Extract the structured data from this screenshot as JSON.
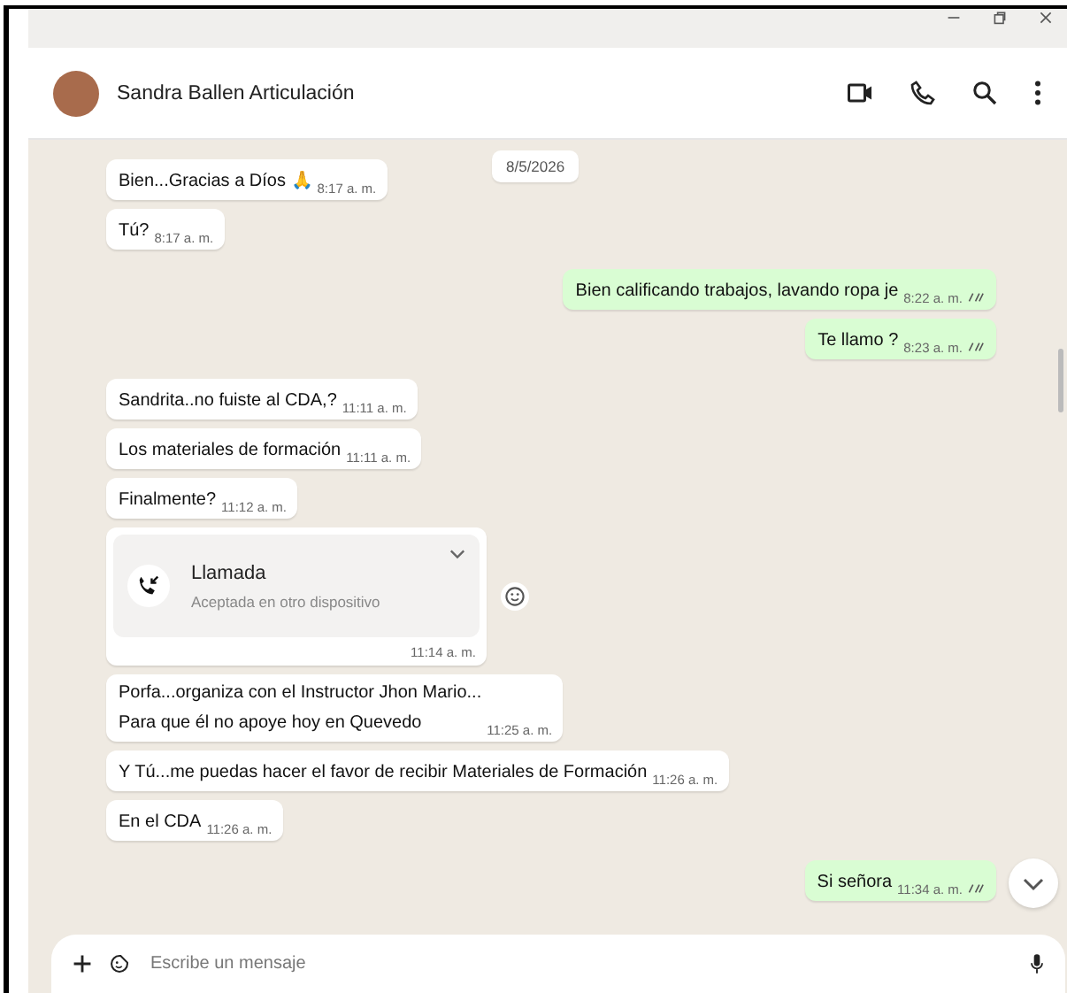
{
  "header": {
    "contact_name": "Sandra Ballen Articulación"
  },
  "date_chip": "8/5/2026",
  "messages": [
    {
      "kind": "incoming",
      "text": "Bien...Gracias a Díos 🙏",
      "time": "8:17 a. m."
    },
    {
      "kind": "incoming",
      "text": "Tú?",
      "time": "8:17 a. m."
    },
    {
      "kind": "outgoing",
      "text": "Bien calificando trabajos, lavando ropa je",
      "time": "8:22 a. m."
    },
    {
      "kind": "outgoing",
      "text": "Te llamo ?",
      "time": "8:23 a. m."
    },
    {
      "kind": "incoming",
      "text": "Sandrita..no fuiste al  CDA,?",
      "time": "11:11 a. m."
    },
    {
      "kind": "incoming",
      "text": "Los materiales de formación",
      "time": "11:11 a. m."
    },
    {
      "kind": "incoming",
      "text": "Finalmente?",
      "time": "11:12 a. m."
    },
    {
      "kind": "call",
      "title": "Llamada",
      "subtitle": "Aceptada en otro dispositivo",
      "time": "11:14 a. m."
    },
    {
      "kind": "incoming",
      "lines": [
        "Porfa...organiza con el Instructor Jhon Mario...",
        "Para que él no apoye hoy en Quevedo"
      ],
      "time": "11:25 a. m."
    },
    {
      "kind": "incoming",
      "text": "Y Tú...me puedas hacer el favor de recibir Materiales de Formación",
      "time": "11:26 a. m."
    },
    {
      "kind": "incoming",
      "text": "En el CDA",
      "time": "11:26 a. m."
    },
    {
      "kind": "outgoing",
      "text": "Si señora",
      "time": "11:34 a. m."
    }
  ],
  "composer": {
    "placeholder": "Escribe un mensaje"
  }
}
